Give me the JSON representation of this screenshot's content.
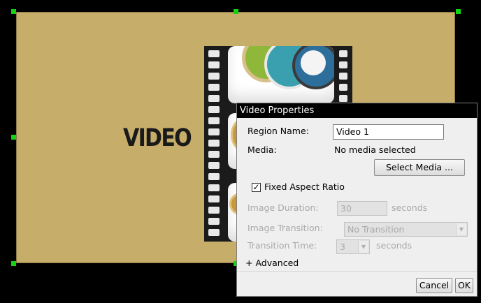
{
  "region": {
    "label": "VIDEO"
  },
  "dialog": {
    "title": "Video Properties",
    "region_name_label": "Region Name:",
    "region_name_value": "Video 1",
    "media_label": "Media:",
    "media_value": "No media selected",
    "select_media_label": "Select Media ...",
    "fixed_aspect_label": "Fixed Aspect Ratio",
    "fixed_aspect_checked": "✓",
    "image_duration_label": "Image Duration:",
    "image_duration_value": "30",
    "image_duration_unit": "seconds",
    "image_transition_label": "Image Transition:",
    "image_transition_value": "No Transition",
    "transition_time_label": "Transition Time:",
    "transition_time_value": "3",
    "transition_time_unit": "seconds",
    "advanced_label": "+  Advanced",
    "cancel_label": "Cancel",
    "ok_label": "OK"
  },
  "colors": {
    "region_bg": "#c6ad69",
    "handle": "#13d313",
    "dialog_title_bg": "#000000"
  }
}
